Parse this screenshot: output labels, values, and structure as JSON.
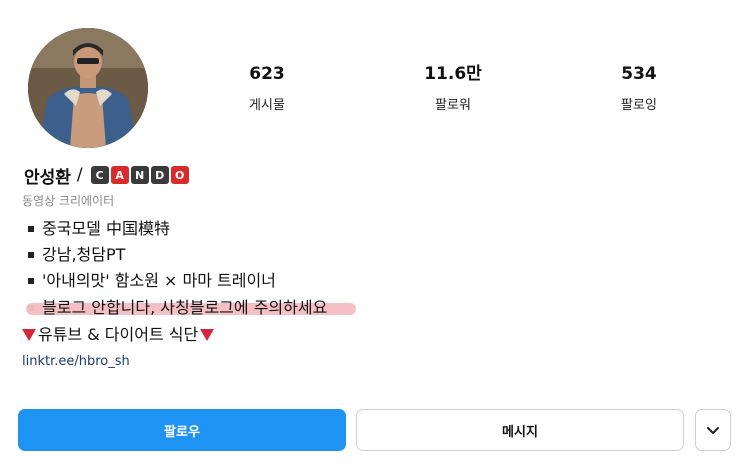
{
  "profile": {
    "name": "안성환",
    "separator": "/",
    "badge_letters": [
      "C",
      "A",
      "N",
      "D",
      "O"
    ],
    "category": "동영상 크리에이터",
    "bio": [
      "중국모델 中国模特",
      "강남,청담PT",
      "'아내의맛' 함소원 × 마마 트레이너",
      "블로그 안합니다, 사칭블로그에 주의하세요",
      "유튜브 & 다이어트 식단"
    ],
    "link": "linktr.ee/hbro_sh"
  },
  "stats": [
    {
      "value": "623",
      "label": "게시물"
    },
    {
      "value": "11.6만",
      "label": "팔로워"
    },
    {
      "value": "534",
      "label": "팔로잉"
    }
  ],
  "actions": {
    "follow_label": "팔로우",
    "message_label": "메시지"
  },
  "icons": {
    "more": "chevron-down-icon",
    "heart": "red-triangle-icon"
  },
  "colors": {
    "accent": "#1f93f1",
    "badge_red": "#d92b2b",
    "badge_dark": "#3a3a3a"
  }
}
